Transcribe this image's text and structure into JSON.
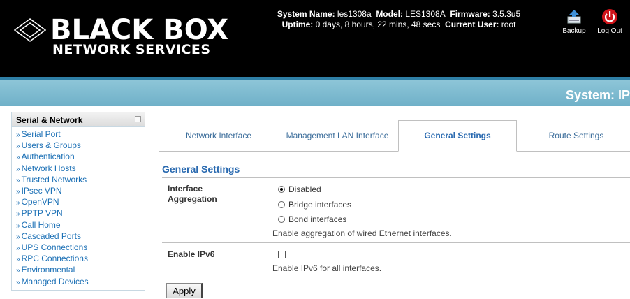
{
  "header": {
    "brand": "BLACK BOX",
    "brand_sub": "NETWORK SERVICES",
    "system_name_label": "System Name:",
    "system_name": "les1308a",
    "model_label": "Model:",
    "model": "LES1308A",
    "firmware_label": "Firmware:",
    "firmware": "3.5.3u5",
    "uptime_label": "Uptime:",
    "uptime": "0 days, 8 hours, 22 mins, 48 secs",
    "current_user_label": "Current User:",
    "current_user": "root",
    "backup_label": "Backup",
    "logout_label": "Log Out"
  },
  "page_title": "System: IP",
  "sidebar": {
    "title": "Serial & Network",
    "items": [
      {
        "label": "Serial Port"
      },
      {
        "label": "Users & Groups"
      },
      {
        "label": "Authentication"
      },
      {
        "label": "Network Hosts"
      },
      {
        "label": "Trusted Networks"
      },
      {
        "label": "IPsec VPN"
      },
      {
        "label": "OpenVPN"
      },
      {
        "label": "PPTP VPN"
      },
      {
        "label": "Call Home"
      },
      {
        "label": "Cascaded Ports"
      },
      {
        "label": "UPS Connections"
      },
      {
        "label": "RPC Connections"
      },
      {
        "label": "Environmental"
      },
      {
        "label": "Managed Devices"
      }
    ]
  },
  "tabs": [
    {
      "label": "Network Interface"
    },
    {
      "label": "Management LAN Interface"
    },
    {
      "label": "General Settings"
    },
    {
      "label": "Route Settings"
    }
  ],
  "section_title": "General Settings",
  "interface_aggregation": {
    "label": "Interface Aggregation",
    "options": [
      "Disabled",
      "Bridge interfaces",
      "Bond interfaces"
    ],
    "selected": "Disabled",
    "help": "Enable aggregation of wired Ethernet interfaces."
  },
  "ipv6": {
    "label": "Enable IPv6",
    "checked": false,
    "help": "Enable IPv6 for all interfaces."
  },
  "apply_label": "Apply",
  "colors": {
    "accent": "#2a6ab0",
    "link": "#1a6fb5",
    "bar": "#6fb0c8",
    "header_bg": "#000000"
  }
}
